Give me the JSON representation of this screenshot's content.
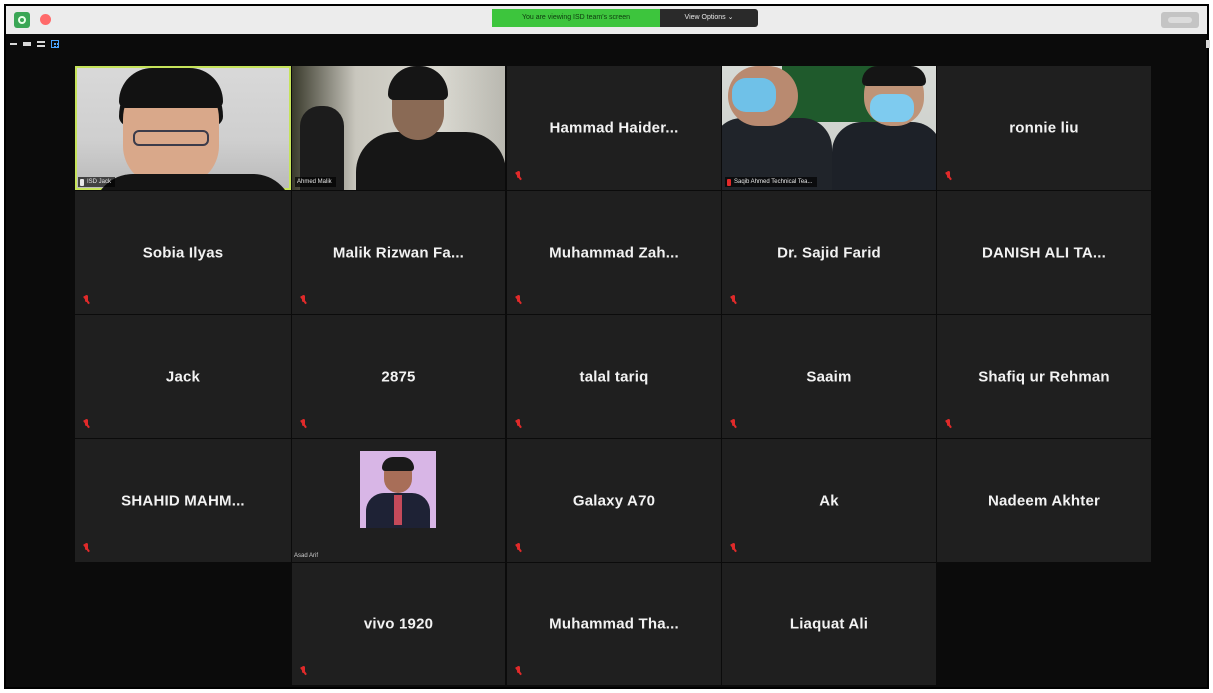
{
  "topbar": {
    "banner_text": "You are viewing ISD team's screen",
    "view_options_label": "View Options ⌄"
  },
  "video_tiles": [
    {
      "label": "ISD Jack"
    },
    {
      "label": "Ahmed Malik"
    },
    {
      "label": "Saqib Ahmed Technical Tea..."
    },
    {
      "label": "Asad Arif"
    }
  ],
  "name_tiles": [
    "Hammad Haider...",
    "ronnie liu",
    "Sobia Ilyas",
    "Malik Rizwan Fa...",
    "Muhammad Zah...",
    "Dr. Sajid Farid",
    "DANISH ALI TA...",
    "Jack",
    "2875",
    "talal tariq",
    "Saaim",
    "Shafiq ur Rehman",
    "SHAHID MAHM...",
    "Galaxy A70",
    "Ak",
    "Nadeem Akhter",
    "vivo 1920",
    "Muhammad Tha...",
    "Liaquat Ali"
  ],
  "colors": {
    "meeting_bg": "#0b0b0b",
    "tile_bg": "#1f1f1f",
    "active_speaker_border": "#c6e35a",
    "banner_green": "#3dc53d",
    "muted_red": "#e02a2a"
  }
}
